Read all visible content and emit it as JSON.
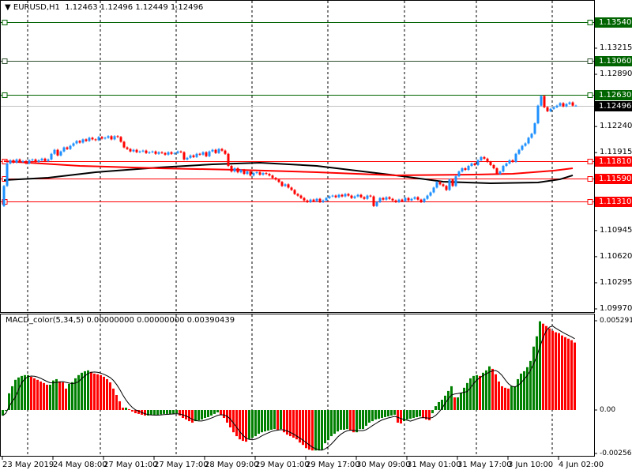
{
  "header": {
    "arrow_icon": "triangle-down-icon",
    "symbol": "EURUSD,H1",
    "ohlc": "1.12463 1.12496 1.12449 1.12496"
  },
  "macd_label": "MACD_color(5,34,5) 0.00000000 0.00000000 0.00390439",
  "price_axis": {
    "min": 1.0997,
    "max": 1.1359,
    "labels": [
      "1.13215",
      "1.12890",
      "1.12240",
      "1.11915",
      "1.10945",
      "1.10620",
      "1.10295",
      "1.09970"
    ]
  },
  "price_tags": [
    {
      "value": "1.13540",
      "color": "#006400",
      "line": "#006400"
    },
    {
      "value": "1.13060",
      "color": "#006400",
      "line": "#2f4f2f"
    },
    {
      "value": "1.12630",
      "color": "#006400",
      "line": "#006400"
    },
    {
      "value": "1.12496",
      "color": "#000000",
      "line": "#C0C0C0"
    },
    {
      "value": "1.11810",
      "color": "#FF0000",
      "line": "#FF0000"
    },
    {
      "value": "1.11590",
      "color": "#FF0000",
      "line": "#FF0000"
    },
    {
      "value": "1.11310",
      "color": "#FF0000",
      "line": "#FF0000"
    }
  ],
  "macd_axis": {
    "labels": [
      "0.0052919",
      "0.00",
      "-0.002569"
    ],
    "max": 0.0052919,
    "min": -0.002569
  },
  "time_labels": [
    "23 May 2019",
    "24 May 08:00",
    "27 May 01:00",
    "27 May 17:00",
    "28 May 09:00",
    "29 May 01:00",
    "29 May 17:00",
    "30 May 09:00",
    "31 May 01:00",
    "31 May 17:00",
    "3 Jun 10:00",
    "4 Jun 02:00"
  ],
  "colors": {
    "up": "#1E90FF",
    "down": "#FF0000",
    "hist_up": "#008000",
    "hist_down": "#FF0000",
    "ma_fast": "#FF0000",
    "ma_slow": "#000000"
  },
  "chart_data": {
    "type": "candlestick",
    "title": "EURUSD,H1",
    "open_first": 1.1125,
    "close": [
      1.115,
      1.1178,
      1.1182,
      1.1179,
      1.1183,
      1.118,
      1.1181,
      1.1178,
      1.1182,
      1.1183,
      1.118,
      1.1182,
      1.1184,
      1.1181,
      1.1183,
      1.119,
      1.1195,
      1.1188,
      1.1193,
      1.1198,
      1.1196,
      1.12,
      1.1203,
      1.1206,
      1.1204,
      1.1208,
      1.1206,
      1.121,
      1.1208,
      1.1207,
      1.1211,
      1.1209,
      1.121,
      1.1212,
      1.1208,
      1.1212,
      1.1211,
      1.1205,
      1.1198,
      1.1196,
      1.1193,
      1.1195,
      1.1192,
      1.1193,
      1.1194,
      1.1191,
      1.1192,
      1.1193,
      1.119,
      1.1192,
      1.1191,
      1.1189,
      1.1192,
      1.119,
      1.1191,
      1.1193,
      1.1192,
      1.1183,
      1.1185,
      1.1188,
      1.1186,
      1.119,
      1.1189,
      1.1192,
      1.1187,
      1.1193,
      1.1195,
      1.1191,
      1.1196,
      1.1194,
      1.119,
      1.1175,
      1.1168,
      1.1172,
      1.1167,
      1.117,
      1.1165,
      1.1168,
      1.1163,
      1.1166,
      1.1167,
      1.1164,
      1.1166,
      1.1165,
      1.1163,
      1.116,
      1.1158,
      1.1155,
      1.115,
      1.1152,
      1.1148,
      1.1145,
      1.114,
      1.1138,
      1.1135,
      1.1132,
      1.113,
      1.1133,
      1.1131,
      1.1134,
      1.113,
      1.1132,
      1.1135,
      1.1137,
      1.1138,
      1.1136,
      1.1139,
      1.1137,
      1.114,
      1.1138,
      1.1135,
      1.1137,
      1.1139,
      1.1136,
      1.1134,
      1.1138,
      1.1137,
      1.1125,
      1.113,
      1.1135,
      1.1133,
      1.1136,
      1.1134,
      1.1132,
      1.113,
      1.1133,
      1.1131,
      1.1135,
      1.1132,
      1.1134,
      1.1136,
      1.1133,
      1.113,
      1.1134,
      1.1138,
      1.1142,
      1.1148,
      1.1155,
      1.1152,
      1.115,
      1.1145,
      1.1158,
      1.115,
      1.1162,
      1.1168,
      1.1172,
      1.117,
      1.1175,
      1.1178,
      1.1176,
      1.1182,
      1.1186,
      1.1184,
      1.118,
      1.1176,
      1.1172,
      1.1165,
      1.1168,
      1.1175,
      1.1178,
      1.1182,
      1.118,
      1.119,
      1.1195,
      1.12,
      1.1203,
      1.121,
      1.1215,
      1.1228,
      1.125,
      1.1262,
      1.1248,
      1.1243,
      1.1246,
      1.1248,
      1.125,
      1.1253,
      1.1249,
      1.1252,
      1.1254,
      1.125,
      1.125
    ],
    "ma_fast": [
      [
        0,
        1.11809
      ],
      [
        24,
        1.1175
      ],
      [
        49,
        1.1172
      ],
      [
        74,
        1.11701
      ],
      [
        99,
        1.11671
      ],
      [
        124,
        1.11632
      ],
      [
        149,
        1.11642
      ],
      [
        161,
        1.11651
      ],
      [
        174,
        1.11691
      ],
      [
        180,
        1.1172
      ]
    ],
    "ma_slow": [
      [
        0,
        1.11573
      ],
      [
        14,
        1.11602
      ],
      [
        29,
        1.11671
      ],
      [
        49,
        1.1173
      ],
      [
        66,
        1.11769
      ],
      [
        81,
        1.11789
      ],
      [
        99,
        1.1175
      ],
      [
        124,
        1.11632
      ],
      [
        139,
        1.11553
      ],
      [
        154,
        1.11534
      ],
      [
        169,
        1.11543
      ],
      [
        176,
        1.11583
      ],
      [
        180,
        1.11632
      ]
    ],
    "macd_histogram_e4": [
      -3.3,
      -0.5,
      9.9,
      14.1,
      17.9,
      19.3,
      20.2,
      20.7,
      20.7,
      19.7,
      18.8,
      17.9,
      16.9,
      16.0,
      15.0,
      15.0,
      17.5,
      18.3,
      17.0,
      16.4,
      12.7,
      15.5,
      16.5,
      18.8,
      20.7,
      22.1,
      23.0,
      23.5,
      22.6,
      21.6,
      21.2,
      20.7,
      19.7,
      18.3,
      16.4,
      12.7,
      8.9,
      5.2,
      1.4,
      1.4,
      0.5,
      -0.9,
      -1.9,
      -2.3,
      -2.8,
      -3.3,
      -3.3,
      -3.0,
      -2.8,
      -2.8,
      -2.6,
      -2.3,
      -2.3,
      -2.3,
      -2.1,
      -1.9,
      -3.3,
      -4.7,
      -5.6,
      -6.6,
      -7.5,
      -6.6,
      -6.1,
      -5.6,
      -4.7,
      -4.2,
      -3.3,
      -2.3,
      -1.4,
      -2.8,
      -4.7,
      -7.5,
      -10.3,
      -13.2,
      -15.5,
      -17.4,
      -18.3,
      -18.8,
      -17.4,
      -16.4,
      -15.5,
      -14.1,
      -13.2,
      -12.7,
      -12.2,
      -11.7,
      -11.3,
      -11.7,
      -11.3,
      -13.2,
      -14.6,
      -15.5,
      -16.4,
      -17.4,
      -19.3,
      -20.7,
      -22.6,
      -23.5,
      -24.0,
      -24.0,
      -24.0,
      -23.5,
      -19.7,
      -17.9,
      -15.5,
      -14.1,
      -12.7,
      -11.7,
      -11.7,
      -11.3,
      -12.2,
      -13.2,
      -13.2,
      -11.3,
      -11.3,
      -9.4,
      -7.5,
      -6.6,
      -5.6,
      -5.2,
      -4.7,
      -4.2,
      -3.8,
      -3.3,
      -2.8,
      -7.5,
      -8.0,
      -6.6,
      -5.6,
      -5.2,
      -4.7,
      -4.2,
      -3.8,
      -4.7,
      -5.6,
      -6.1,
      -1.9,
      2.3,
      4.7,
      6.1,
      8.5,
      11.3,
      14.1,
      7.5,
      7.5,
      10.3,
      13.2,
      16.0,
      18.8,
      20.2,
      20.7,
      20.2,
      22.1,
      23.5,
      25.9,
      24.4,
      21.2,
      16.9,
      14.1,
      13.2,
      12.7,
      14.1,
      14.1,
      18.3,
      21.6,
      23.0,
      25.4,
      29.1,
      37.6,
      43.7,
      52.6,
      51.2,
      49.8,
      48.4,
      47.0,
      46.1,
      45.6,
      44.2,
      43.2,
      42.3,
      41.4,
      40.0
    ],
    "macd_signal_period": 5,
    "grid": "vertical-dashed"
  }
}
